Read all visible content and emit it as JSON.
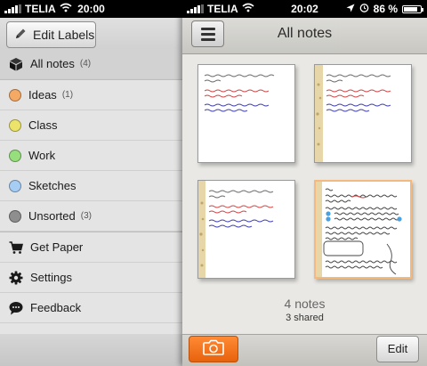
{
  "left": {
    "status": {
      "carrier": "TELIA",
      "time": "20:00"
    },
    "toolbar": {
      "edit_labels": "Edit Labels"
    },
    "menu": {
      "all_notes": {
        "label": "All notes",
        "count": "(4)"
      },
      "labels": [
        {
          "label": "Ideas",
          "count": "(1)",
          "color": "#f4a964"
        },
        {
          "label": "Class",
          "count": "",
          "color": "#ece46a"
        },
        {
          "label": "Work",
          "count": "",
          "color": "#97de7d"
        },
        {
          "label": "Sketches",
          "count": "",
          "color": "#a6cdf4"
        },
        {
          "label": "Unsorted",
          "count": "(3)",
          "color": "#8e8e8e"
        }
      ],
      "actions": [
        {
          "label": "Get Paper",
          "icon": "cart-icon"
        },
        {
          "label": "Settings",
          "icon": "gear-icon"
        },
        {
          "label": "Feedback",
          "icon": "chat-bubble-icon"
        }
      ]
    }
  },
  "right": {
    "status": {
      "carrier": "TELIA",
      "time": "20:02",
      "battery": "86 %",
      "battery_level": 0.86
    },
    "title": "All notes",
    "notes_count": "4 notes",
    "shared_count": "3 shared",
    "edit_label": "Edit",
    "camera_icon": "camera-icon",
    "accent_color": "#f47420"
  }
}
